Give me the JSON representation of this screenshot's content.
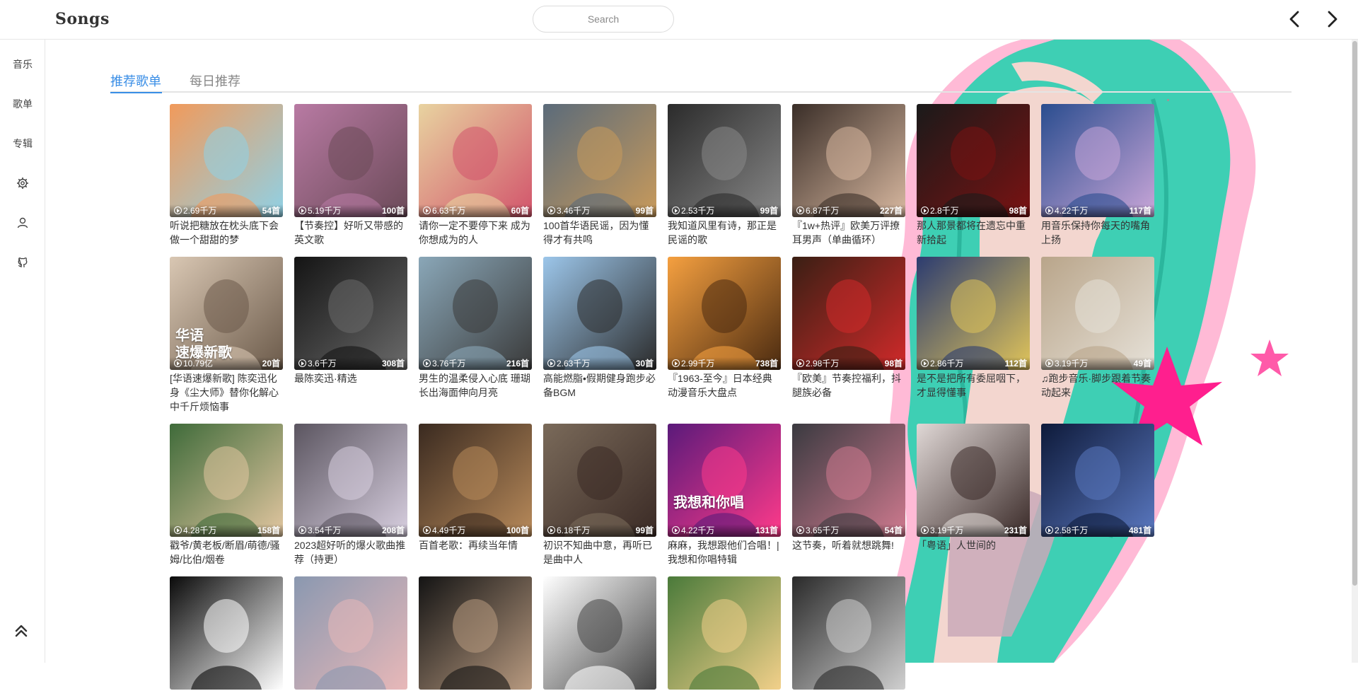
{
  "app": {
    "title": "Songs"
  },
  "search": {
    "placeholder": "Search"
  },
  "sidebar": {
    "items": [
      {
        "label": "音乐"
      },
      {
        "label": "歌单"
      },
      {
        "label": "专辑"
      },
      {
        "icon": "gear-icon"
      },
      {
        "icon": "user-icon"
      },
      {
        "icon": "github-icon"
      }
    ],
    "back_to_top_icon": "double-chevron-up-icon"
  },
  "tabs": [
    {
      "label": "推荐歌单",
      "active": true
    },
    {
      "label": "每日推荐",
      "active": false
    }
  ],
  "colors": {
    "accent": "#3a8ee6",
    "text": "#333333",
    "tab_inactive": "#888888"
  },
  "playlists": [
    {
      "plays": "2.69千万",
      "count": "54首",
      "title": "听说把糖放在枕头底下会做一个甜甜的梦"
    },
    {
      "plays": "5.19千万",
      "count": "100首",
      "title": "【节奏控】好听又带感的英文歌"
    },
    {
      "plays": "6.63千万",
      "count": "60首",
      "title": "请你一定不要停下来 成为你想成为的人"
    },
    {
      "plays": "3.46千万",
      "count": "99首",
      "title": "100首华语民谣，因为懂得才有共鸣"
    },
    {
      "plays": "2.53千万",
      "count": "99首",
      "title": "我知道风里有诗，那正是民谣的歌"
    },
    {
      "plays": "6.87千万",
      "count": "227首",
      "title": "『1w+热评』欧美万评撩耳男声（单曲循环）"
    },
    {
      "plays": "2.8千万",
      "count": "98首",
      "title": "那人那景都将在遗忘中重新拾起"
    },
    {
      "plays": "4.22千万",
      "count": "117首",
      "title": "用音乐保持你每天的嘴角上扬"
    },
    {
      "plays": "10.79亿",
      "count": "20首",
      "title": "[华语速爆新歌] 陈奕迅化身《尘大师》替你化解心中千斤烦恼事",
      "overlay": "华语\n速爆新歌"
    },
    {
      "plays": "3.6千万",
      "count": "308首",
      "title": "最陈奕迅·精选"
    },
    {
      "plays": "3.76千万",
      "count": "216首",
      "title": "男生的温柔侵入心底 珊瑚长出海面伸向月亮"
    },
    {
      "plays": "2.63千万",
      "count": "30首",
      "title": "高能燃脂•假期健身跑步必备BGM"
    },
    {
      "plays": "2.99千万",
      "count": "738首",
      "title": "『1963-至今』日本经典动漫音乐大盘点"
    },
    {
      "plays": "2.98千万",
      "count": "98首",
      "title": "『欧美』节奏控福利，抖腿族必备"
    },
    {
      "plays": "2.86千万",
      "count": "112首",
      "title": "是不是把所有委屈咽下，才显得懂事"
    },
    {
      "plays": "3.19千万",
      "count": "49首",
      "title": "♫跑步音乐·脚步跟着节奏动起来"
    },
    {
      "plays": "4.28千万",
      "count": "158首",
      "title": "戳爷/黄老板/断眉/萌德/骚姆/比伯/烟卷"
    },
    {
      "plays": "3.54千万",
      "count": "208首",
      "title": "2023超好听的爆火歌曲推荐（持更）"
    },
    {
      "plays": "4.49千万",
      "count": "100首",
      "title": "百首老歌：再续当年情"
    },
    {
      "plays": "6.18千万",
      "count": "99首",
      "title": "初识不知曲中意，再听已是曲中人"
    },
    {
      "plays": "4.22千万",
      "count": "131首",
      "title": "麻麻，我想跟他们合唱！| 我想和你唱特辑",
      "overlay": "我想和你唱"
    },
    {
      "plays": "3.65千万",
      "count": "54首",
      "title": "这节奏，听着就想跳舞!"
    },
    {
      "plays": "3.19千万",
      "count": "231首",
      "title": "「粤语」人世间的"
    },
    {
      "plays": "2.58千万",
      "count": "481首",
      "title": ""
    },
    {
      "plays": "",
      "count": "",
      "title": ""
    },
    {
      "plays": "",
      "count": "",
      "title": ""
    },
    {
      "plays": "",
      "count": "",
      "title": ""
    },
    {
      "plays": "",
      "count": "",
      "title": ""
    },
    {
      "plays": "",
      "count": "",
      "title": ""
    },
    {
      "plays": "",
      "count": "",
      "title": ""
    }
  ]
}
